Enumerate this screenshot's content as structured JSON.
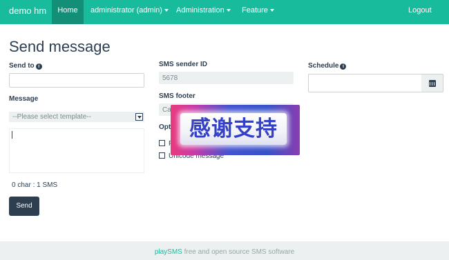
{
  "navbar": {
    "brand": "demo hm",
    "items": [
      {
        "label": "Home",
        "active": true
      },
      {
        "label": "administrator (admin)",
        "dropdown": true
      },
      {
        "label": "Administration",
        "dropdown": true
      },
      {
        "label": "Feature",
        "dropdown": true
      }
    ],
    "logout": "Logout"
  },
  "page": {
    "title": "Send message"
  },
  "form": {
    "send_to": {
      "label": "Send to",
      "value": ""
    },
    "message": {
      "label": "Message",
      "template_select": "--Please select template--",
      "text": ""
    },
    "counter": "0 char : 1 SMS",
    "send_label": "Send",
    "sms_sender_id": {
      "label": "SMS sender ID",
      "value": "5678"
    },
    "sms_footer": {
      "label": "SMS footer",
      "value": "Ca"
    },
    "options": {
      "label": "Opt",
      "flash": "F",
      "unicode": "Unicode message"
    },
    "schedule": {
      "label": "Schedule",
      "value": ""
    }
  },
  "overlay": {
    "text": "感谢支持"
  },
  "footer": {
    "brand": "playSMS",
    "text": " free and open source SMS software"
  },
  "colors": {
    "navbar": "#18bc9c",
    "nav_active": "#128f76",
    "primary": "#2c3e50",
    "muted": "#ecf0f1"
  }
}
